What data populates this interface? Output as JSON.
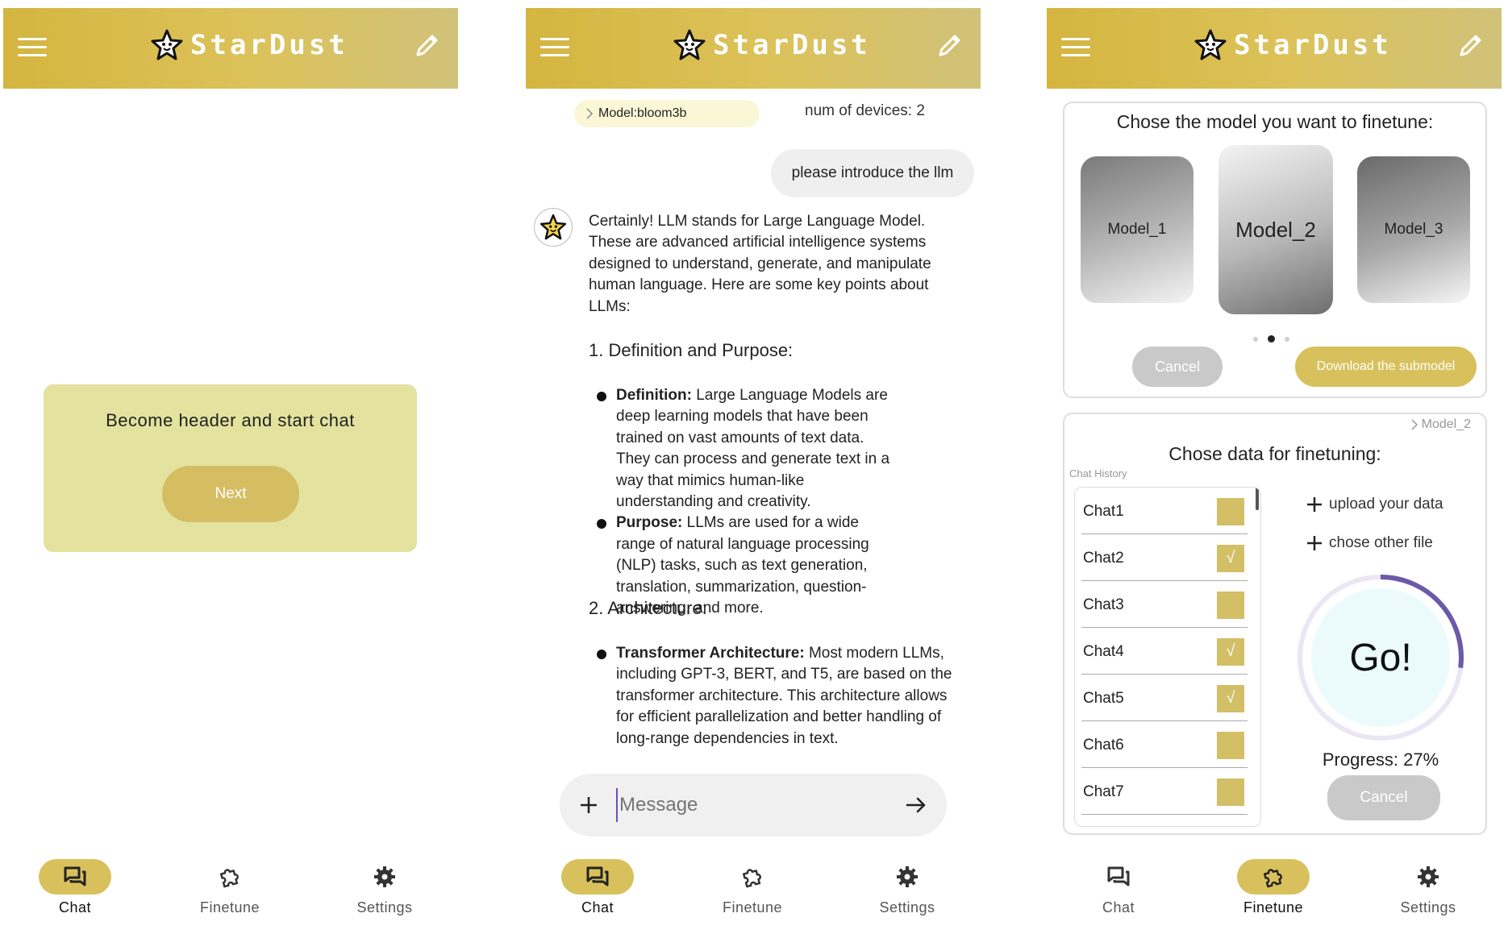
{
  "app": {
    "brand": "StarDust"
  },
  "nav": {
    "chat": "Chat",
    "finetune": "Finetune",
    "settings": "Settings"
  },
  "screen1": {
    "card_title": "Become header and start chat",
    "next_label": "Next"
  },
  "screen2": {
    "model_chip": "Model:bloom3b",
    "devices": "num of devices: 2",
    "user_message": "please introduce the llm",
    "reply": {
      "intro": "Certainly! LLM stands for Large Language Model. These are advanced artificial intelligence systems designed to understand, generate, and manipulate human language. Here are some key points about LLMs:",
      "section1_title": "1. Definition and Purpose:",
      "def_term": "Definition:",
      "def_text": " Large Language Models are deep learning models that have been trained on vast amounts of text data. They can process and generate text in a way that mimics human-like understanding and creativity.",
      "purpose_term": "Purpose:",
      "purpose_text": " LLMs are used for a wide range of natural language processing (NLP) tasks, such as text generation, translation, summarization, question-answering, and more.",
      "section2_title": "2. Architecture:",
      "arch_term": "Transformer Architecture:",
      "arch_text": " Most modern LLMs, including GPT-3, BERT, and T5, are based on the transformer architecture. This architecture allows for efficient parallelization and better handling of long-range dependencies in text."
    },
    "composer_placeholder": "Message"
  },
  "screen3": {
    "model_title": "Chose the model you want to finetune:",
    "models": [
      "Model_1",
      "Model_2",
      "Model_3"
    ],
    "selected_model_index": 1,
    "cancel_label": "Cancel",
    "download_label": "Download the submodel",
    "crumb": "Model_2",
    "data_title": "Chose data for finetuning:",
    "history_label": "Chat History",
    "chats": [
      {
        "name": "Chat1",
        "checked": false
      },
      {
        "name": "Chat2",
        "checked": true
      },
      {
        "name": "Chat3",
        "checked": false
      },
      {
        "name": "Chat4",
        "checked": true
      },
      {
        "name": "Chat5",
        "checked": true
      },
      {
        "name": "Chat6",
        "checked": false
      },
      {
        "name": "Chat7",
        "checked": false
      }
    ],
    "check_glyph": "√",
    "upload_label": "upload your data",
    "other_file_label": "chose other file",
    "go_label": "Go!",
    "progress_text": "Progress: 27%",
    "progress_value": 27,
    "progress_cancel_label": "Cancel"
  },
  "colors": {
    "accent": "#d8c15c",
    "header": "#d4b53f",
    "card": "#e3e29e",
    "ring": "#6b5aa8",
    "go": "#ebfbfc"
  }
}
